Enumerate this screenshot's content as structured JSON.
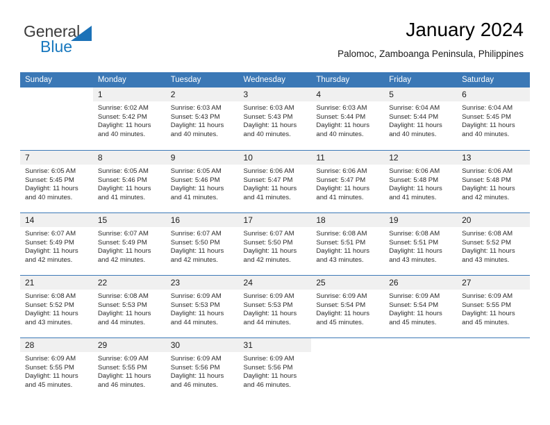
{
  "brand": {
    "name_part1": "General",
    "name_part2": "Blue",
    "triangle_color": "#1b72b8",
    "text_color": "#3b3b3b"
  },
  "header": {
    "title": "January 2024",
    "location": "Palomoc, Zamboanga Peninsula, Philippines"
  },
  "theme": {
    "header_bg": "#3b78b6",
    "daynum_bg": "#f0f0f0",
    "separator": "#3b78b6",
    "text": "#2b2b2b"
  },
  "weekdays": [
    "Sunday",
    "Monday",
    "Tuesday",
    "Wednesday",
    "Thursday",
    "Friday",
    "Saturday"
  ],
  "labels": {
    "sunrise": "Sunrise:",
    "sunset": "Sunset:",
    "daylight": "Daylight:"
  },
  "weeks": [
    [
      {
        "day": "",
        "empty": true
      },
      {
        "day": "1",
        "sunrise": "Sunrise: 6:02 AM",
        "sunset": "Sunset: 5:42 PM",
        "daylight1": "Daylight: 11 hours",
        "daylight2": "and 40 minutes."
      },
      {
        "day": "2",
        "sunrise": "Sunrise: 6:03 AM",
        "sunset": "Sunset: 5:43 PM",
        "daylight1": "Daylight: 11 hours",
        "daylight2": "and 40 minutes."
      },
      {
        "day": "3",
        "sunrise": "Sunrise: 6:03 AM",
        "sunset": "Sunset: 5:43 PM",
        "daylight1": "Daylight: 11 hours",
        "daylight2": "and 40 minutes."
      },
      {
        "day": "4",
        "sunrise": "Sunrise: 6:03 AM",
        "sunset": "Sunset: 5:44 PM",
        "daylight1": "Daylight: 11 hours",
        "daylight2": "and 40 minutes."
      },
      {
        "day": "5",
        "sunrise": "Sunrise: 6:04 AM",
        "sunset": "Sunset: 5:44 PM",
        "daylight1": "Daylight: 11 hours",
        "daylight2": "and 40 minutes."
      },
      {
        "day": "6",
        "sunrise": "Sunrise: 6:04 AM",
        "sunset": "Sunset: 5:45 PM",
        "daylight1": "Daylight: 11 hours",
        "daylight2": "and 40 minutes."
      }
    ],
    [
      {
        "day": "7",
        "sunrise": "Sunrise: 6:05 AM",
        "sunset": "Sunset: 5:45 PM",
        "daylight1": "Daylight: 11 hours",
        "daylight2": "and 40 minutes."
      },
      {
        "day": "8",
        "sunrise": "Sunrise: 6:05 AM",
        "sunset": "Sunset: 5:46 PM",
        "daylight1": "Daylight: 11 hours",
        "daylight2": "and 41 minutes."
      },
      {
        "day": "9",
        "sunrise": "Sunrise: 6:05 AM",
        "sunset": "Sunset: 5:46 PM",
        "daylight1": "Daylight: 11 hours",
        "daylight2": "and 41 minutes."
      },
      {
        "day": "10",
        "sunrise": "Sunrise: 6:06 AM",
        "sunset": "Sunset: 5:47 PM",
        "daylight1": "Daylight: 11 hours",
        "daylight2": "and 41 minutes."
      },
      {
        "day": "11",
        "sunrise": "Sunrise: 6:06 AM",
        "sunset": "Sunset: 5:47 PM",
        "daylight1": "Daylight: 11 hours",
        "daylight2": "and 41 minutes."
      },
      {
        "day": "12",
        "sunrise": "Sunrise: 6:06 AM",
        "sunset": "Sunset: 5:48 PM",
        "daylight1": "Daylight: 11 hours",
        "daylight2": "and 41 minutes."
      },
      {
        "day": "13",
        "sunrise": "Sunrise: 6:06 AM",
        "sunset": "Sunset: 5:48 PM",
        "daylight1": "Daylight: 11 hours",
        "daylight2": "and 42 minutes."
      }
    ],
    [
      {
        "day": "14",
        "sunrise": "Sunrise: 6:07 AM",
        "sunset": "Sunset: 5:49 PM",
        "daylight1": "Daylight: 11 hours",
        "daylight2": "and 42 minutes."
      },
      {
        "day": "15",
        "sunrise": "Sunrise: 6:07 AM",
        "sunset": "Sunset: 5:49 PM",
        "daylight1": "Daylight: 11 hours",
        "daylight2": "and 42 minutes."
      },
      {
        "day": "16",
        "sunrise": "Sunrise: 6:07 AM",
        "sunset": "Sunset: 5:50 PM",
        "daylight1": "Daylight: 11 hours",
        "daylight2": "and 42 minutes."
      },
      {
        "day": "17",
        "sunrise": "Sunrise: 6:07 AM",
        "sunset": "Sunset: 5:50 PM",
        "daylight1": "Daylight: 11 hours",
        "daylight2": "and 42 minutes."
      },
      {
        "day": "18",
        "sunrise": "Sunrise: 6:08 AM",
        "sunset": "Sunset: 5:51 PM",
        "daylight1": "Daylight: 11 hours",
        "daylight2": "and 43 minutes."
      },
      {
        "day": "19",
        "sunrise": "Sunrise: 6:08 AM",
        "sunset": "Sunset: 5:51 PM",
        "daylight1": "Daylight: 11 hours",
        "daylight2": "and 43 minutes."
      },
      {
        "day": "20",
        "sunrise": "Sunrise: 6:08 AM",
        "sunset": "Sunset: 5:52 PM",
        "daylight1": "Daylight: 11 hours",
        "daylight2": "and 43 minutes."
      }
    ],
    [
      {
        "day": "21",
        "sunrise": "Sunrise: 6:08 AM",
        "sunset": "Sunset: 5:52 PM",
        "daylight1": "Daylight: 11 hours",
        "daylight2": "and 43 minutes."
      },
      {
        "day": "22",
        "sunrise": "Sunrise: 6:08 AM",
        "sunset": "Sunset: 5:53 PM",
        "daylight1": "Daylight: 11 hours",
        "daylight2": "and 44 minutes."
      },
      {
        "day": "23",
        "sunrise": "Sunrise: 6:09 AM",
        "sunset": "Sunset: 5:53 PM",
        "daylight1": "Daylight: 11 hours",
        "daylight2": "and 44 minutes."
      },
      {
        "day": "24",
        "sunrise": "Sunrise: 6:09 AM",
        "sunset": "Sunset: 5:53 PM",
        "daylight1": "Daylight: 11 hours",
        "daylight2": "and 44 minutes."
      },
      {
        "day": "25",
        "sunrise": "Sunrise: 6:09 AM",
        "sunset": "Sunset: 5:54 PM",
        "daylight1": "Daylight: 11 hours",
        "daylight2": "and 45 minutes."
      },
      {
        "day": "26",
        "sunrise": "Sunrise: 6:09 AM",
        "sunset": "Sunset: 5:54 PM",
        "daylight1": "Daylight: 11 hours",
        "daylight2": "and 45 minutes."
      },
      {
        "day": "27",
        "sunrise": "Sunrise: 6:09 AM",
        "sunset": "Sunset: 5:55 PM",
        "daylight1": "Daylight: 11 hours",
        "daylight2": "and 45 minutes."
      }
    ],
    [
      {
        "day": "28",
        "sunrise": "Sunrise: 6:09 AM",
        "sunset": "Sunset: 5:55 PM",
        "daylight1": "Daylight: 11 hours",
        "daylight2": "and 45 minutes."
      },
      {
        "day": "29",
        "sunrise": "Sunrise: 6:09 AM",
        "sunset": "Sunset: 5:55 PM",
        "daylight1": "Daylight: 11 hours",
        "daylight2": "and 46 minutes."
      },
      {
        "day": "30",
        "sunrise": "Sunrise: 6:09 AM",
        "sunset": "Sunset: 5:56 PM",
        "daylight1": "Daylight: 11 hours",
        "daylight2": "and 46 minutes."
      },
      {
        "day": "31",
        "sunrise": "Sunrise: 6:09 AM",
        "sunset": "Sunset: 5:56 PM",
        "daylight1": "Daylight: 11 hours",
        "daylight2": "and 46 minutes."
      },
      {
        "day": "",
        "empty": true
      },
      {
        "day": "",
        "empty": true
      },
      {
        "day": "",
        "empty": true
      }
    ]
  ]
}
